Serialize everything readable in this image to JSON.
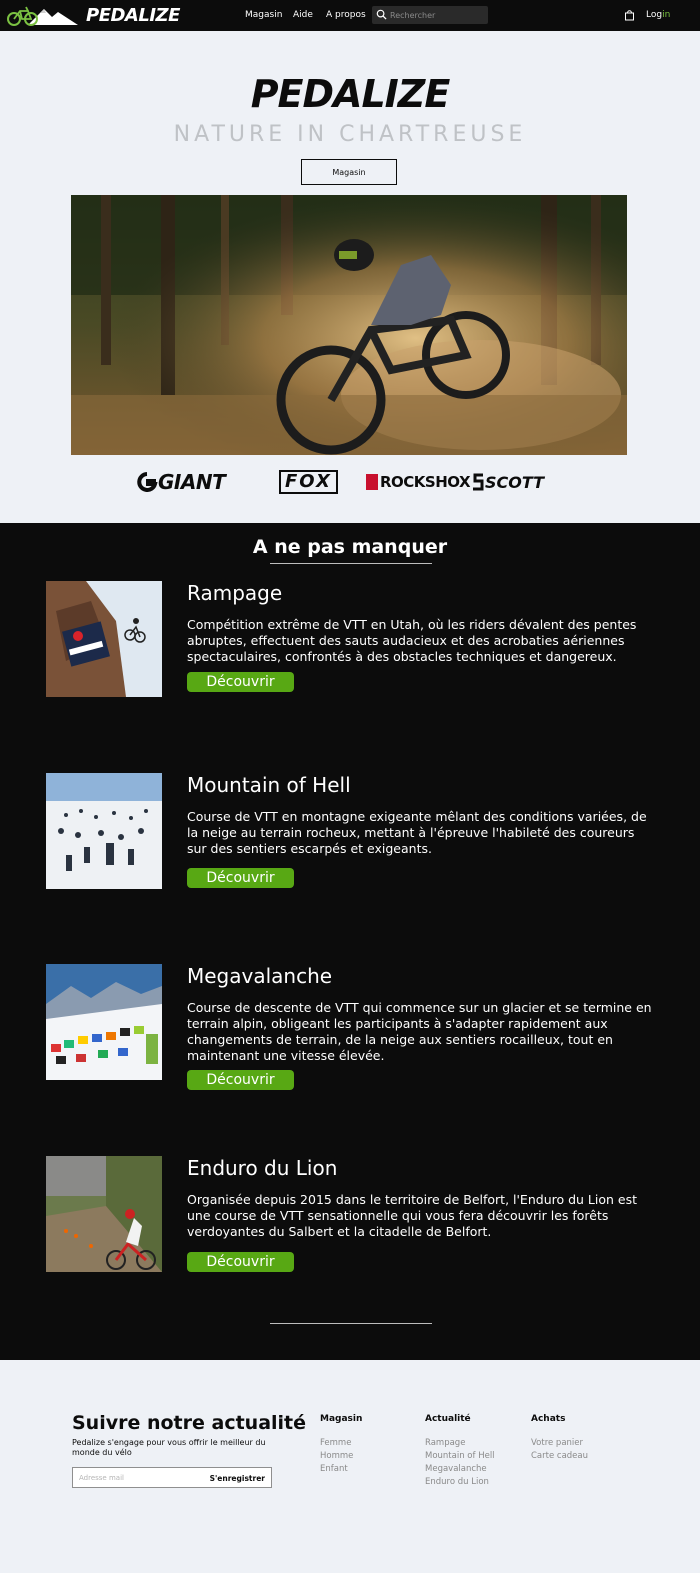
{
  "nav": {
    "brand": "PEDALIZE",
    "menu": [
      "Magasin",
      "Aide",
      "A propos"
    ],
    "search_placeholder": "Rechercher",
    "login_main": "Log",
    "login_accent": "in"
  },
  "hero": {
    "title": "PEDALIZE",
    "subtitle": "NATURE IN CHARTREUSE",
    "shop_button": "Magasin",
    "brands": [
      "GIANT",
      "FOX",
      "ROCKSHOX",
      "SCOTT"
    ]
  },
  "events": {
    "section_title": "A ne pas manquer",
    "cta_label": "Découvrir",
    "items": [
      {
        "name": "Rampage",
        "description": "Compétition extrême de VTT en Utah, où les riders dévalent des pentes abruptes, effectuent des sauts audacieux et des acrobaties aériennes spectaculaires, confrontés à des obstacles techniques et dangereux."
      },
      {
        "name": "Mountain of Hell",
        "description": "Course de VTT en montagne exigeante mêlant des conditions variées, de la neige au terrain rocheux, mettant à l'épreuve l'habileté des coureurs sur des sentiers escarpés et exigeants."
      },
      {
        "name": "Megavalanche",
        "description": "Course de descente de VTT qui commence sur un glacier et se termine en terrain alpin, obligeant les participants à s'adapter rapidement aux changements de terrain, de la neige aux sentiers rocailleux, tout en maintenant une vitesse élevée."
      },
      {
        "name": "Enduro du Lion",
        "description": "Organisée depuis 2015 dans le territoire de Belfort, l'Enduro du Lion est une course de VTT sensationnelle qui vous fera découvrir les forêts verdoyantes du Salbert et la citadelle de Belfort."
      }
    ]
  },
  "footer": {
    "title": "Suivre notre actualité",
    "subtitle": "Pedalize s'engage pour vous offrir le meilleur du monde du vélo",
    "email_placeholder": "Adresse mail",
    "register_button": "S'enregistrer",
    "columns": [
      {
        "title": "Magasin",
        "links": [
          "Femme",
          "Homme",
          "Enfant"
        ]
      },
      {
        "title": "Actualité",
        "links": [
          "Rampage",
          "Mountain of Hell",
          "Megavalanche",
          "Enduro du Lion"
        ]
      },
      {
        "title": "Achats",
        "links": [
          "Votre panier",
          "Carte cadeau"
        ]
      }
    ]
  },
  "colors": {
    "accent_green": "#58a814",
    "logo_green": "#7bc142",
    "dark": "#0c0c0c",
    "light_bg": "#eef1f6"
  },
  "icons": [
    "bike-mountain-logo-icon",
    "search-icon",
    "shopping-bag-icon"
  ]
}
